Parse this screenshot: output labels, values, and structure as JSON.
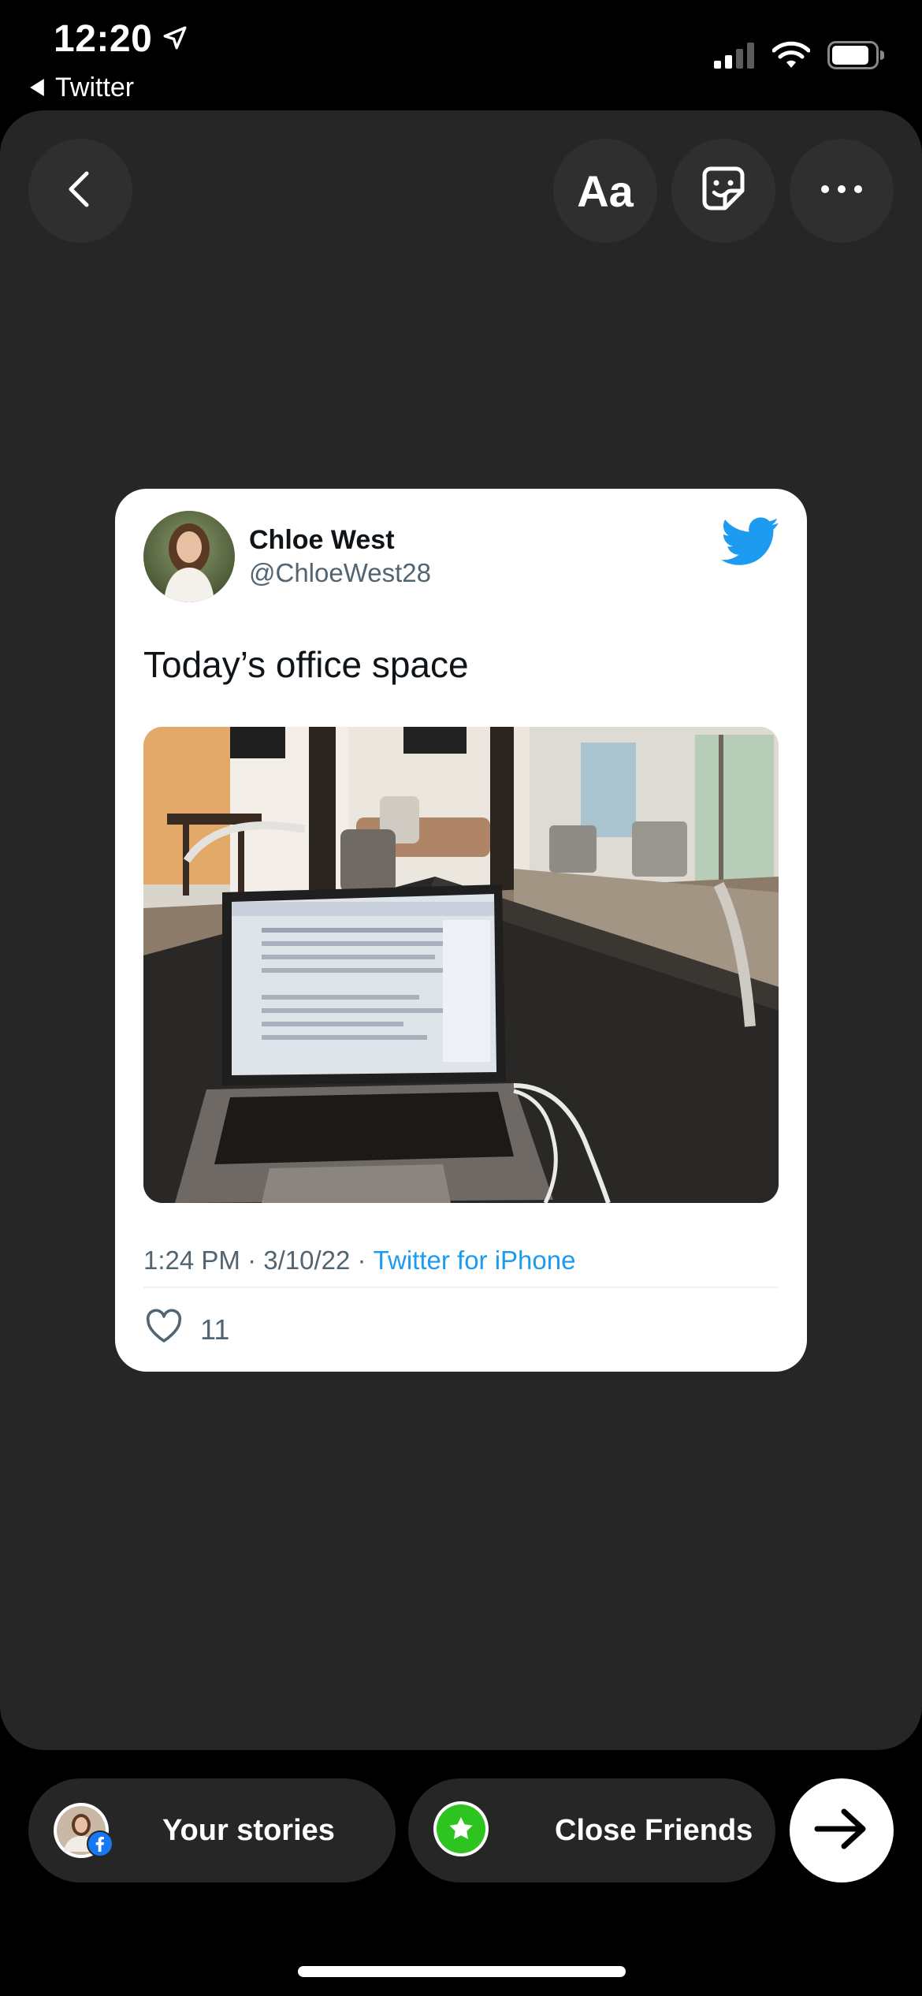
{
  "status_bar": {
    "time": "12:20",
    "back_app": "Twitter",
    "icons": [
      "location-arrow-icon",
      "cellular-signal-icon",
      "wifi-icon",
      "battery-icon"
    ]
  },
  "toolbar": {
    "text_button": "Aa",
    "icons": [
      "back-chevron-icon",
      "sticker-icon",
      "more-icon"
    ]
  },
  "tweet": {
    "name": "Chloe West",
    "handle": "@ChloeWest28",
    "text": "Today’s office space",
    "time": "1:24 PM",
    "date": "3/10/22",
    "separator": " · ",
    "source": "Twitter for iPhone",
    "likes": "11",
    "brand_color": "#1d9bf0"
  },
  "share": {
    "your_stories": "Your stories",
    "close_friends": "Close Friends",
    "close_friends_color": "#2ec41f"
  }
}
